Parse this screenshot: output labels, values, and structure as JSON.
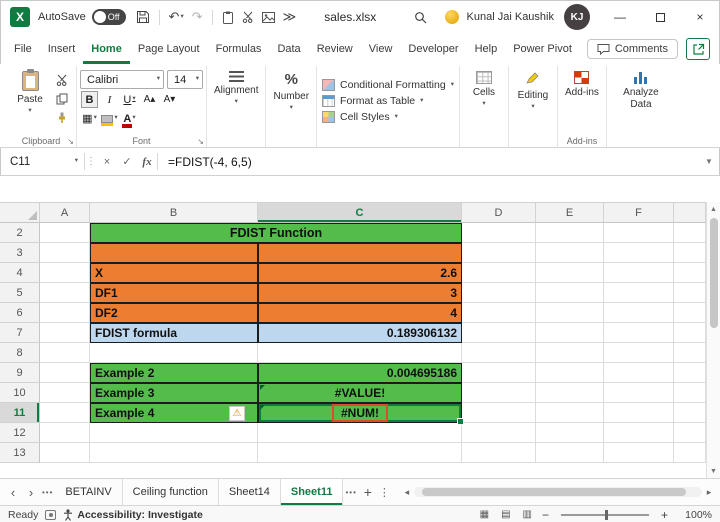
{
  "titlebar": {
    "autosave_label": "AutoSave",
    "autosave_state": "Off",
    "filename": "sales.xlsx",
    "user_name": "Kunal Jai Kaushik",
    "user_initials": "KJ"
  },
  "tabs": {
    "items": [
      "File",
      "Insert",
      "Home",
      "Page Layout",
      "Formulas",
      "Data",
      "Review",
      "View",
      "Developer",
      "Help",
      "Power Pivot"
    ],
    "active": "Home",
    "comments_label": "Comments"
  },
  "ribbon": {
    "paste_label": "Paste",
    "clipboard_group": "Clipboard",
    "font": {
      "name": "Calibri",
      "size": "14",
      "group": "Font"
    },
    "alignment_label": "Alignment",
    "number_label": "Number",
    "styles": {
      "condit​ional_formatting": "",
      "conditional_formatting": "Conditional Formatting",
      "format_as_table": "Format as Table",
      "cell_styles": "Cell Styles"
    },
    "cells_label": "Cells",
    "editing_label": "Editing",
    "addins_label": "Add-ins",
    "addins_group": "Add-ins",
    "analyze_label": "Analyze Data"
  },
  "formula_bar": {
    "name_box": "C11",
    "formula": "=FDIST(-4, 6,5)"
  },
  "grid": {
    "col_headers": [
      "A",
      "B",
      "C",
      "D",
      "E",
      "F"
    ],
    "active_col": "C",
    "active_row": 11,
    "rows": [
      {
        "n": 2,
        "b": "FDIST Function",
        "c": "",
        "style": "title"
      },
      {
        "n": 3,
        "b": "",
        "c": "",
        "style": "orange"
      },
      {
        "n": 4,
        "b": "X",
        "c": "2.6",
        "style": "orange",
        "c_align": "right"
      },
      {
        "n": 5,
        "b": "DF1",
        "c": "3",
        "style": "orange",
        "c_align": "right"
      },
      {
        "n": 6,
        "b": "DF2",
        "c": "4",
        "style": "orange",
        "c_align": "right"
      },
      {
        "n": 7,
        "b": "FDIST formula",
        "c": "0.189306132",
        "style": "blue",
        "c_align": "right"
      },
      {
        "n": 8,
        "b": "",
        "c": "",
        "style": "plain"
      },
      {
        "n": 9,
        "b": "Example 2",
        "c": "0.004695186",
        "style": "green",
        "c_align": "right"
      },
      {
        "n": 10,
        "b": "Example 3",
        "c": "#VALUE!",
        "style": "green",
        "c_align": "center",
        "flag": true
      },
      {
        "n": 11,
        "b": "Example 4",
        "c": "#NUM!",
        "style": "green",
        "c_align": "center",
        "active": true,
        "warning": true,
        "error_box": true,
        "flag": true
      },
      {
        "n": 12,
        "b": "",
        "c": "",
        "style": "plain"
      },
      {
        "n": 13,
        "b": "",
        "c": "",
        "style": "plain"
      }
    ]
  },
  "sheet_tabs": {
    "items": [
      "BETAINV",
      "Ceiling function",
      "Sheet14",
      "Sheet11"
    ],
    "active": "Sheet11"
  },
  "status_bar": {
    "ready": "Ready",
    "accessibility": "Accessibility: Investigate",
    "zoom": "100%"
  },
  "colors": {
    "accent_green": "#107C41",
    "fill_green": "#54BC4B",
    "fill_orange": "#ED7D31",
    "fill_blue": "#BDD7EE",
    "error_box_red": "#E04B2F"
  },
  "icons": {
    "undo": "↶",
    "redo": "↷",
    "more-commands": "≫",
    "dropdown": "▾",
    "minimize": "—",
    "close": "×",
    "bold": "B",
    "italic": "I",
    "underline": "U",
    "grow-font": "A▴",
    "shrink-font": "A▾",
    "borders": "▦",
    "percent": "%",
    "font-color": "A",
    "cancel": "×",
    "enter": "✓",
    "fx": "fx",
    "menu-dots": "⋮",
    "warning": "⚠",
    "nav-left": "‹",
    "nav-right": "›",
    "more-sheets": "•••",
    "new-sheet": "+",
    "scroll-up": "▲",
    "scroll-down": "▼",
    "scroll-left": "◂",
    "scroll-right": "▸",
    "view-normal": "▦",
    "view-layout": "▤",
    "view-break": "▥",
    "zoom-out": "−",
    "zoom-in": "+"
  }
}
